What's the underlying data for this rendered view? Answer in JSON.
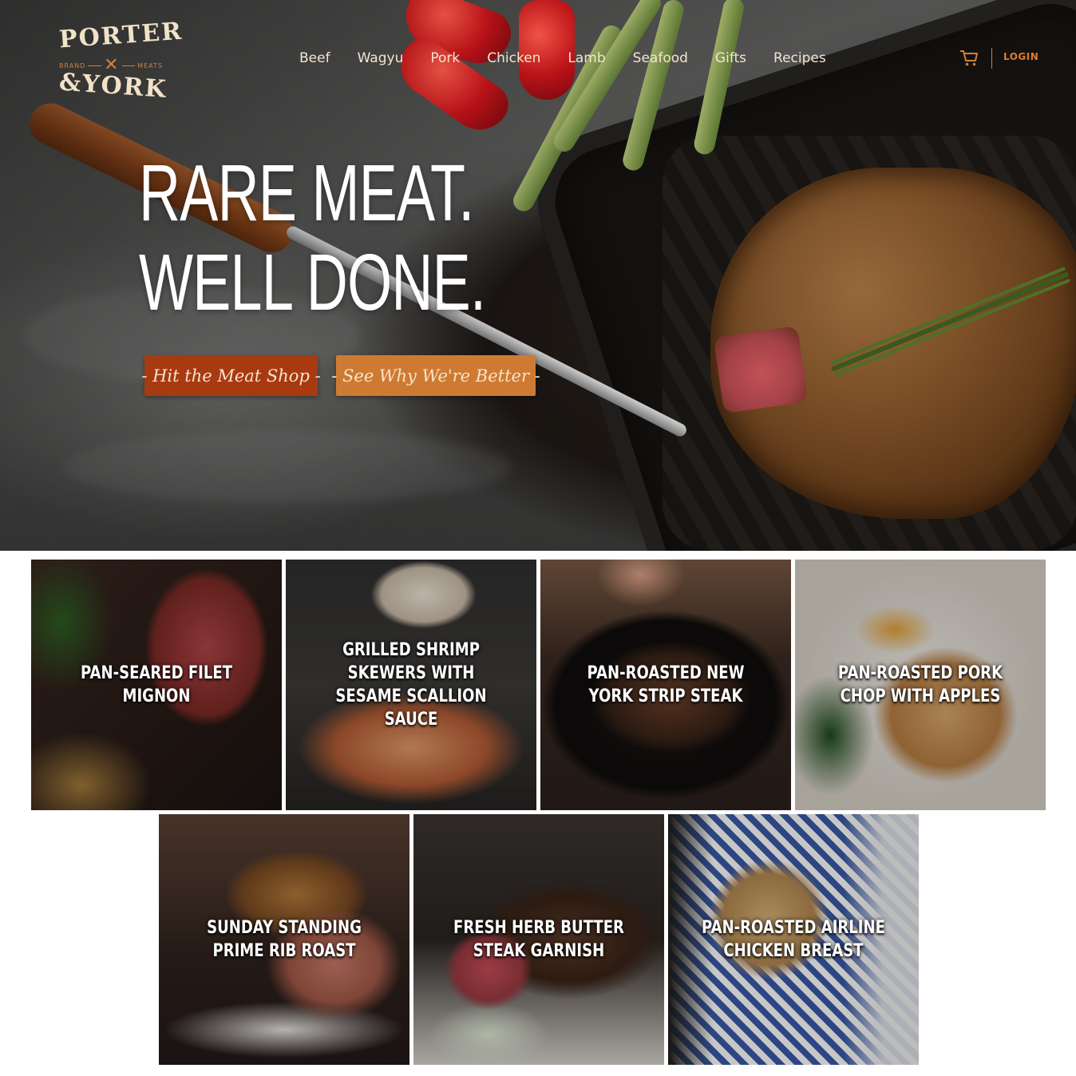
{
  "brand": {
    "logo_top": "PORTER",
    "logo_left": "BRAND",
    "logo_right": "MEATS",
    "logo_bottom": "&YORK",
    "accent_color": "#d0803a"
  },
  "nav": {
    "items": [
      "Beef",
      "Wagyu",
      "Pork",
      "Chicken",
      "Lamb",
      "Seafood",
      "Gifts",
      "Recipes"
    ],
    "cart_icon": "cart-icon",
    "login_label": "LOGIN"
  },
  "hero": {
    "headline_line1": "RARE MEAT.",
    "headline_line2": "WELL DONE.",
    "primary_cta": "- Hit the Meat Shop -",
    "secondary_cta": "- See Why We're Better -",
    "primary_cta_color": "#a83a12",
    "secondary_cta_color": "#cf7a33"
  },
  "recipes": {
    "row1": [
      {
        "title": "PAN-SEARED FILET MIGNON"
      },
      {
        "title": "GRILLED SHRIMP SKEWERS WITH SESAME SCALLION SAUCE"
      },
      {
        "title": "PAN-ROASTED NEW YORK STRIP STEAK"
      },
      {
        "title": "PAN-ROASTED PORK CHOP WITH APPLES"
      }
    ],
    "row2": [
      {
        "title": "SUNDAY STANDING PRIME RIB ROAST"
      },
      {
        "title": "FRESH HERB BUTTER STEAK GARNISH"
      },
      {
        "title": "PAN-ROASTED AIRLINE CHICKEN BREAST"
      }
    ]
  }
}
